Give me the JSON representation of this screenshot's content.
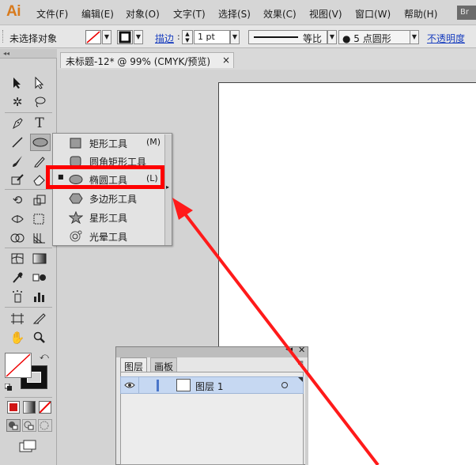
{
  "app": {
    "logo": "Ai",
    "bridge_badge": "Br"
  },
  "menubar": {
    "items": [
      "文件(F)",
      "编辑(E)",
      "对象(O)",
      "文字(T)",
      "选择(S)",
      "效果(C)",
      "视图(V)",
      "窗口(W)",
      "帮助(H)"
    ]
  },
  "controlbar": {
    "selection_status": "未选择对象",
    "stroke_label": "描边",
    "stroke_weight": "1 pt",
    "profile_label": "等比",
    "brush_label": "5 点圆形",
    "opacity_label": "不透明度"
  },
  "document": {
    "tab_title": "未标题-12* @ 99% (CMYK/预览)",
    "tab_close": "×"
  },
  "flyout": {
    "items": [
      {
        "label": "矩形工具",
        "shortcut": "(M)",
        "icon": "rectangle-icon",
        "active": false
      },
      {
        "label": "圆角矩形工具",
        "shortcut": "",
        "icon": "rounded-rectangle-icon",
        "active": false
      },
      {
        "label": "椭圆工具",
        "shortcut": "(L)",
        "icon": "ellipse-icon",
        "active": true
      },
      {
        "label": "多边形工具",
        "shortcut": "",
        "icon": "polygon-icon",
        "active": false
      },
      {
        "label": "星形工具",
        "shortcut": "",
        "icon": "star-icon",
        "active": false
      },
      {
        "label": "光晕工具",
        "shortcut": "",
        "icon": "flare-icon",
        "active": false
      }
    ],
    "active_marker": "■"
  },
  "layers_panel": {
    "tabs": [
      "图层",
      "画板"
    ],
    "layer_name": "图层 1"
  },
  "colors": {
    "highlight": "#ff0000",
    "arrow": "#ff1a1a",
    "logo": "#d87a1c",
    "layer_selected": "#c6d8f2"
  }
}
